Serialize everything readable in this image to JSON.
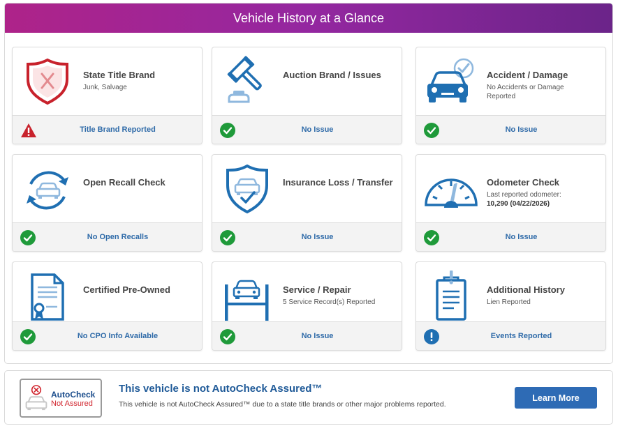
{
  "header": {
    "title": "Vehicle History at a Glance"
  },
  "colors": {
    "header_start": "#ae2389",
    "header_end": "#6b2489",
    "icon_blue": "#1f6fb2",
    "status_green": "#1f9a3a",
    "alert_red": "#c8222c",
    "link_blue": "#2e6aa8"
  },
  "cards": [
    {
      "title": "State Title Brand",
      "sub": "Junk, Salvage",
      "status": "Title Brand Reported",
      "status_icon": "warning-icon",
      "icon": "shield-x-icon"
    },
    {
      "title": "Auction Brand / Issues",
      "sub": "",
      "status": "No Issue",
      "status_icon": "check-icon",
      "icon": "gavel-icon"
    },
    {
      "title": "Accident / Damage",
      "sub": "No Accidents or Damage Reported",
      "status": "No Issue",
      "status_icon": "check-icon",
      "icon": "car-check-icon"
    },
    {
      "title": "Open Recall Check",
      "sub": "",
      "status": "No Open Recalls",
      "status_icon": "check-icon",
      "icon": "recall-car-icon"
    },
    {
      "title": "Insurance Loss / Transfer",
      "sub": "",
      "status": "No Issue",
      "status_icon": "check-icon",
      "icon": "shield-car-icon"
    },
    {
      "title": "Odometer Check",
      "sub": "Last reported odometer:",
      "sub_bold": "10,290 (04/22/2026)",
      "status": "No Issue",
      "status_icon": "check-icon",
      "icon": "odometer-icon"
    },
    {
      "title": "Certified Pre-Owned",
      "sub": "",
      "status": "No CPO Info Available",
      "status_icon": "check-icon",
      "icon": "certificate-icon"
    },
    {
      "title": "Service / Repair",
      "sub": "5 Service Record(s) Reported",
      "status": "No Issue",
      "status_icon": "check-icon",
      "icon": "car-lift-icon"
    },
    {
      "title": "Additional History",
      "sub": "Lien Reported",
      "status": "Events Reported",
      "status_icon": "info-icon",
      "icon": "document-alert-icon"
    }
  ],
  "assured": {
    "badge_line1": "AutoCheck",
    "badge_line2": "Not Assured",
    "heading": "This vehicle is not AutoCheck Assured™",
    "description": "This vehicle is not AutoCheck Assured™ due to a state title brands or other major problems reported.",
    "button_label": "Learn More"
  }
}
